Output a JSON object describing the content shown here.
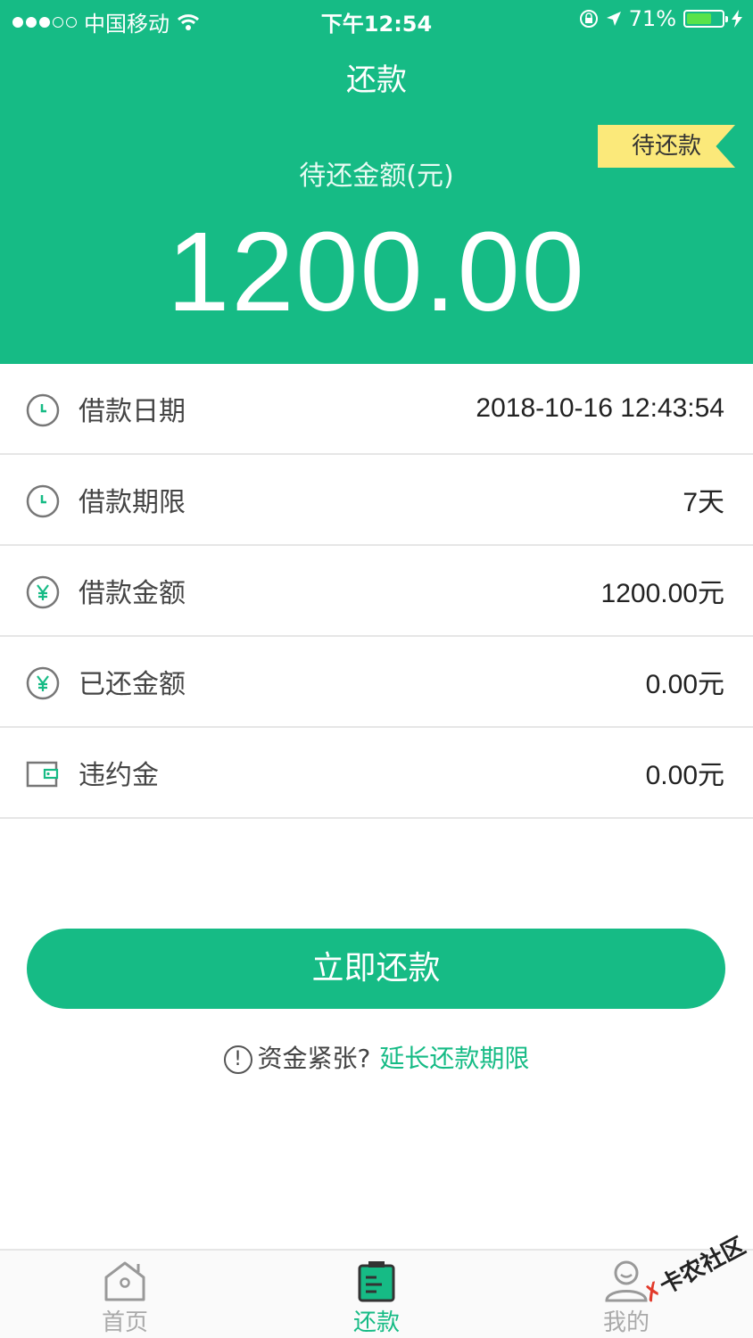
{
  "status_bar": {
    "carrier": "中国移动",
    "time": "下午12:54",
    "battery_percent": "71%",
    "battery_level": 0.71
  },
  "header": {
    "title": "还款",
    "badge": "待还款",
    "amount_label": "待还金额(元)",
    "amount": "1200.00"
  },
  "details": [
    {
      "icon": "clock-icon",
      "label": "借款日期",
      "value": "2018-10-16 12:43:54"
    },
    {
      "icon": "clock-icon",
      "label": "借款期限",
      "value": "7天"
    },
    {
      "icon": "yen-icon",
      "label": "借款金额",
      "value": "1200.00元"
    },
    {
      "icon": "yen-icon",
      "label": "已还金额",
      "value": "0.00元"
    },
    {
      "icon": "wallet-icon",
      "label": "违约金",
      "value": "0.00元"
    }
  ],
  "actions": {
    "pay_now": "立即还款",
    "hint_text": "资金紧张?",
    "extend_link": "延长还款期限"
  },
  "tabbar": {
    "home": "首页",
    "repay": "还款",
    "mine": "我的"
  },
  "watermark": "卡农社区",
  "colors": {
    "brand": "#16bb85",
    "badge": "#fbe97a"
  }
}
